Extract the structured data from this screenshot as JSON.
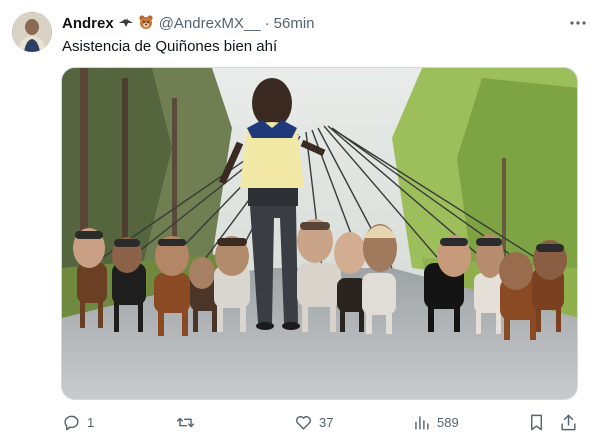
{
  "author": {
    "display_name": "Andrex",
    "emojis": [
      "eagle-emoji",
      "bear-emoji"
    ],
    "handle": "@AndrexMX__",
    "separator": "·",
    "time_ago": "56min"
  },
  "tweet": {
    "text": "Asistencia de Quiñones bien ahí"
  },
  "actions": {
    "replies": "1",
    "retweets": "",
    "likes": "37",
    "views": "589"
  },
  "colors": {
    "text_primary": "#0f1419",
    "text_secondary": "#536471",
    "border": "#cfd9de",
    "shirt_yellow": "#f3e9a6",
    "shirt_blue": "#1f3a7a"
  },
  "icons": [
    "more-icon",
    "reply-icon",
    "retweet-icon",
    "like-icon",
    "views-icon",
    "bookmark-icon",
    "share-icon"
  ]
}
